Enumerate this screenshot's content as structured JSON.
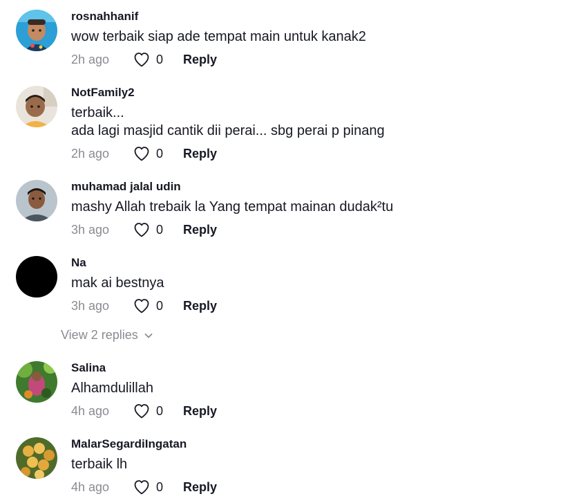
{
  "comments": [
    {
      "username": "rosnahhanif",
      "lines": [
        "wow terbaik siap ade tempat main untuk kanak2"
      ],
      "time": "2h ago",
      "likes": "0",
      "reply": "Reply",
      "avatar": "avatar-child-photo"
    },
    {
      "username": "NotFamily2",
      "lines": [
        "terbaik...",
        "ada lagi masjid cantik dii perai... sbg perai p pinang"
      ],
      "time": "2h ago",
      "likes": "0",
      "reply": "Reply",
      "avatar": "avatar-boy-photo"
    },
    {
      "username": "muhamad jalal udin",
      "lines": [
        "mashy Allah trebaik la Yang tempat mainan dudak²tu"
      ],
      "time": "3h ago",
      "likes": "0",
      "reply": "Reply",
      "avatar": "avatar-man-photo"
    },
    {
      "username": "Na",
      "lines": [
        "mak ai bestnya"
      ],
      "time": "3h ago",
      "likes": "0",
      "reply": "Reply",
      "avatar": "avatar-black"
    },
    {
      "username": "Salina",
      "lines": [
        "Alhamdulillah"
      ],
      "time": "4h ago",
      "likes": "0",
      "reply": "Reply",
      "avatar": "avatar-nature-photo"
    },
    {
      "username": "MalarSegardiIngatan",
      "lines": [
        "terbaik lh"
      ],
      "time": "4h ago",
      "likes": "0",
      "reply": "Reply",
      "avatar": "avatar-fruit-photo"
    }
  ],
  "view_replies": {
    "label": "View 2 replies"
  },
  "icons": {
    "like": "heart-outline-icon",
    "expand": "chevron-down-icon"
  },
  "colors": {
    "text": "#161823",
    "muted": "#8a8b91",
    "background": "#ffffff"
  }
}
